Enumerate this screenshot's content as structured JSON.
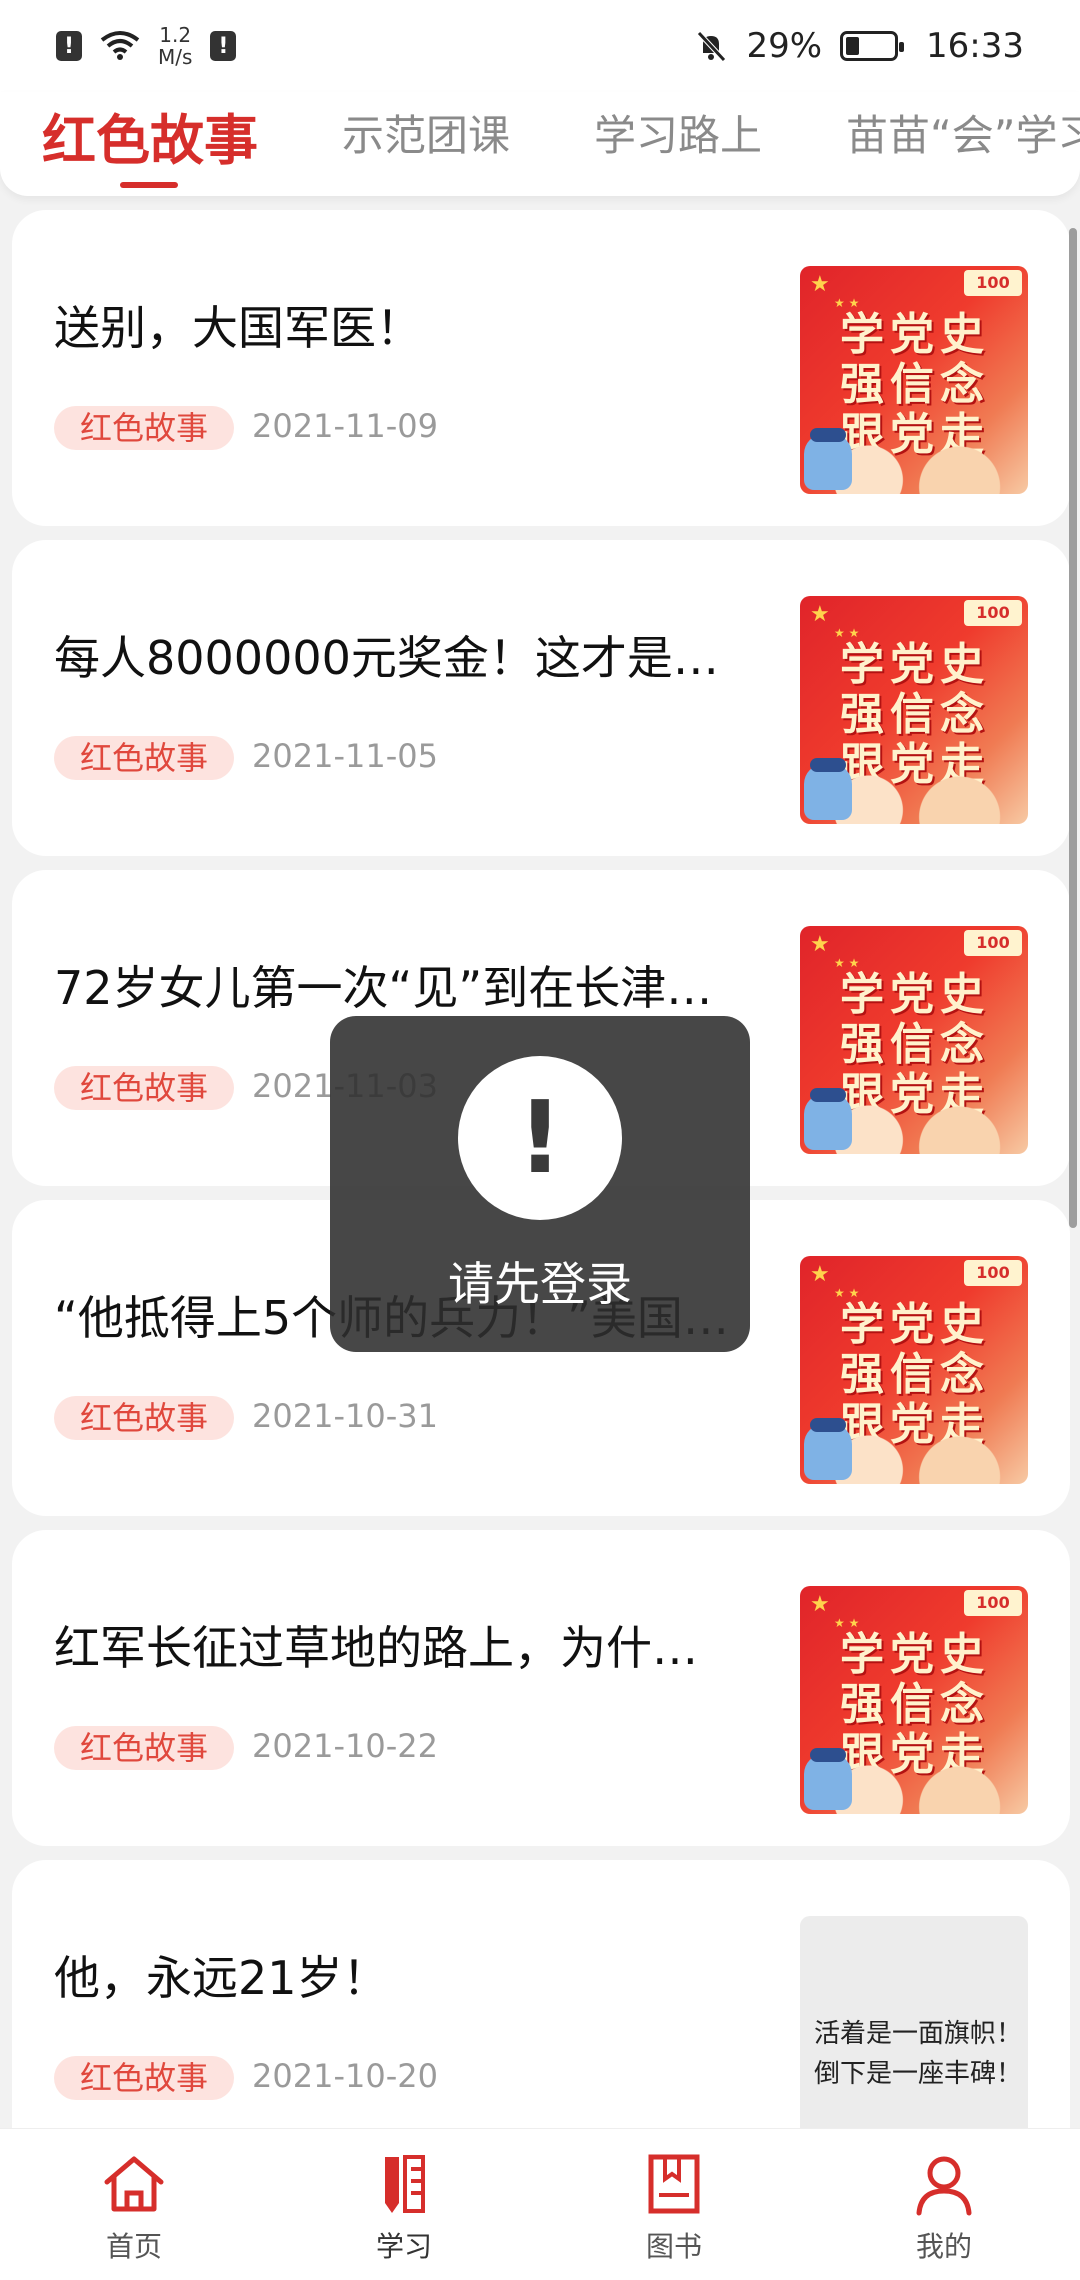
{
  "status_bar": {
    "net_speed_value": "1.2",
    "net_speed_unit": "M/s",
    "battery_text": "29%",
    "battery_level": 0.29,
    "time": "16:33",
    "icons": [
      "alert-icon",
      "wifi-icon",
      "alert-icon",
      "mute-bell-icon",
      "battery-icon"
    ]
  },
  "tabs": [
    {
      "label": "红色故事",
      "active": true
    },
    {
      "label": "示范团课",
      "active": false
    },
    {
      "label": "学习路上",
      "active": false
    },
    {
      "label": "苗苗“会”学习",
      "active": false
    }
  ],
  "articles": [
    {
      "title": "送别，大国军医！",
      "tag": "红色故事",
      "date": "2021-11-09",
      "thumb": "red-poster"
    },
    {
      "title": "每人8000000元奖金！这才是…",
      "tag": "红色故事",
      "date": "2021-11-05",
      "thumb": "red-poster"
    },
    {
      "title": "72岁女儿第一次“见”到在长津…",
      "tag": "红色故事",
      "date": "2021-11-03",
      "thumb": "red-poster"
    },
    {
      "title": "“他抵得上5个师的兵力！”美国…",
      "tag": "红色故事",
      "date": "2021-10-31",
      "thumb": "red-poster"
    },
    {
      "title": "红军长征过草地的路上，为什…",
      "tag": "红色故事",
      "date": "2021-10-22",
      "thumb": "red-poster"
    },
    {
      "title": "他，永远21岁！",
      "tag": "红色故事",
      "date": "2021-10-20",
      "thumb": "gray-caption"
    }
  ],
  "thumb_poster": {
    "slogan": [
      "学党史",
      "强信念",
      "跟党走"
    ],
    "badge": "100"
  },
  "thumb_caption": [
    "活着是一面旗帜！",
    "倒下是一座丰碑！"
  ],
  "toast": {
    "icon": "exclamation-icon",
    "symbol": "!",
    "message": "请先登录"
  },
  "bottom_nav": [
    {
      "label": "首页",
      "icon": "home-icon",
      "active": false
    },
    {
      "label": "学习",
      "icon": "study-icon",
      "active": true
    },
    {
      "label": "图书",
      "icon": "book-icon",
      "active": false
    },
    {
      "label": "我的",
      "icon": "profile-icon",
      "active": false
    }
  ],
  "colors": {
    "accent": "#d62e2b",
    "tag_bg": "#fde3df",
    "tag_text": "#e0483d",
    "background": "#f2f2f2"
  }
}
